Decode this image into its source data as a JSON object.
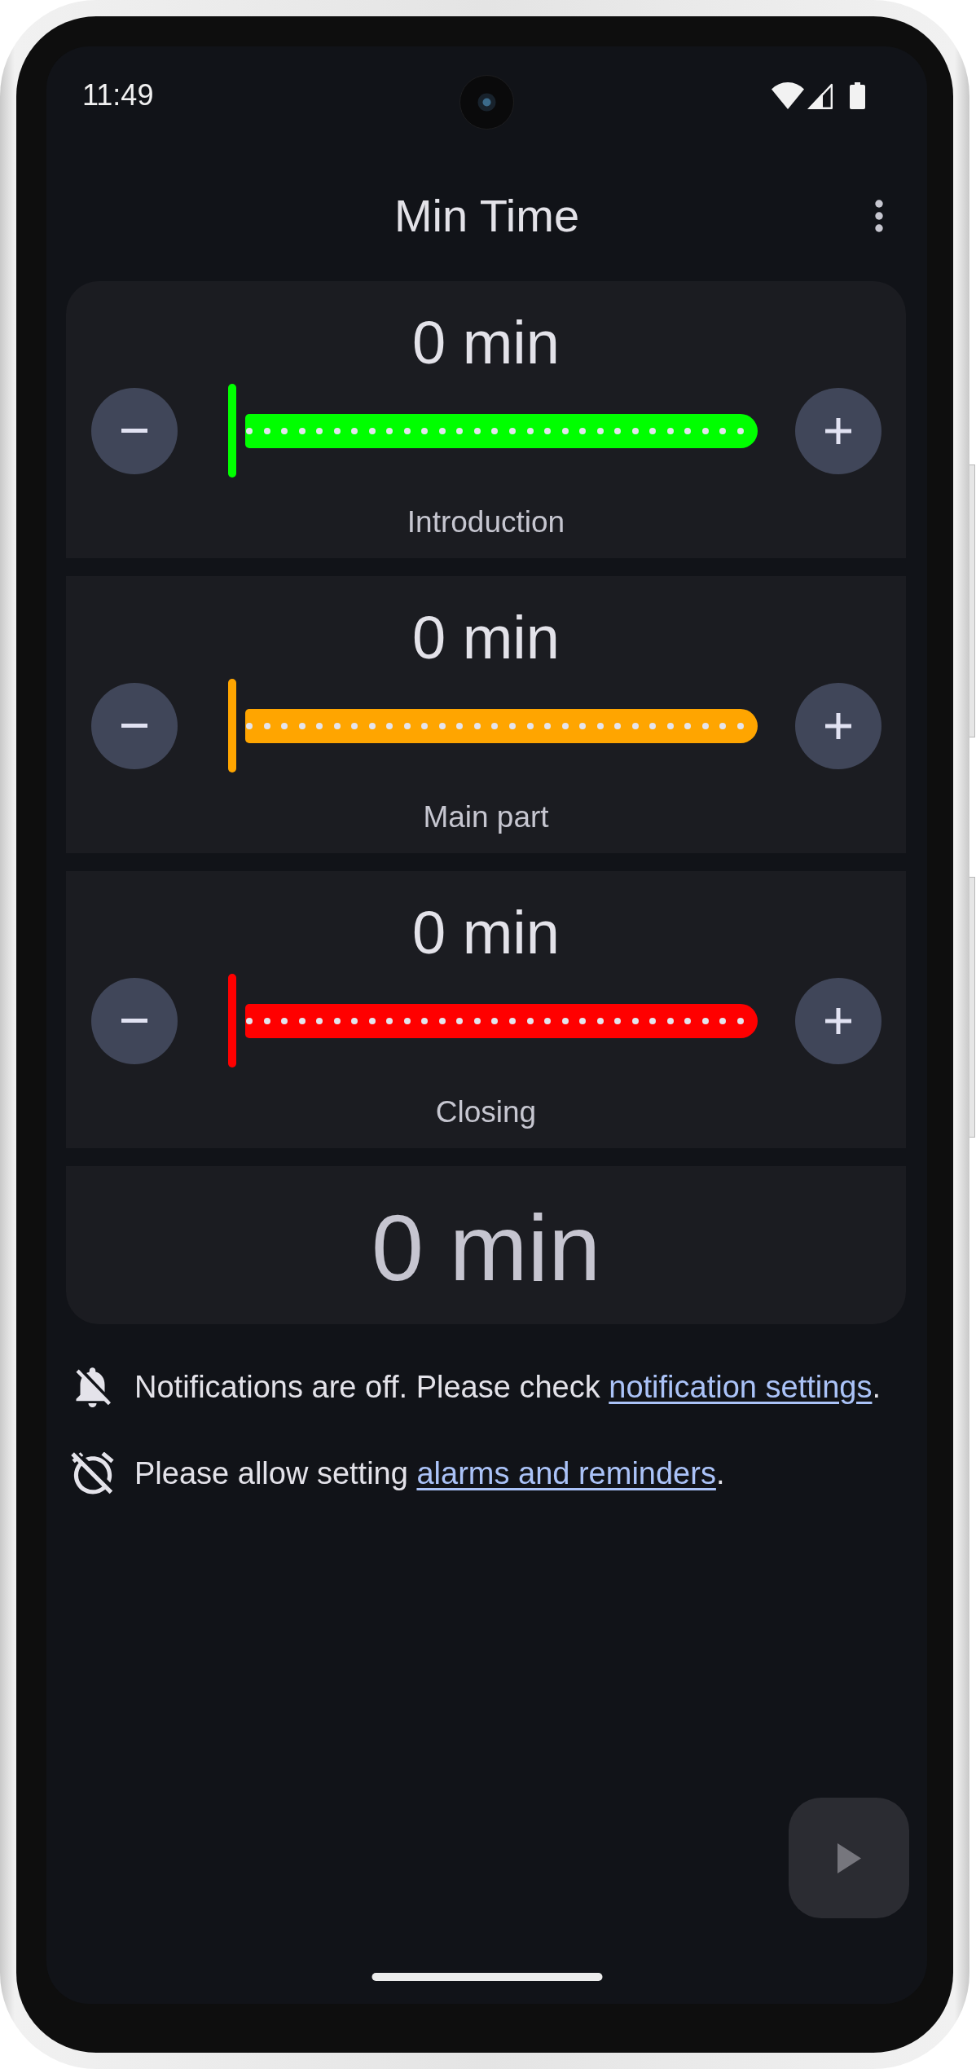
{
  "status_bar": {
    "time": "11:49"
  },
  "app_bar": {
    "title": "Min Time"
  },
  "segments": [
    {
      "duration": "0 min",
      "label": "Introduction",
      "color": "#00ff00",
      "level": 0
    },
    {
      "duration": "0 min",
      "label": "Main part",
      "color": "#ffa500",
      "level": 0
    },
    {
      "duration": "0 min",
      "label": "Closing",
      "color": "#ff0000",
      "level": 0
    }
  ],
  "total": {
    "duration": "0 min"
  },
  "notices": [
    {
      "kind": "notifications",
      "text": "Notifications are off. Please check ",
      "link": "notification settings",
      "after": "."
    },
    {
      "kind": "alarms",
      "text": "Please allow setting ",
      "link": "alarms and reminders",
      "after": "."
    }
  ],
  "fab": {
    "disabled": true
  }
}
